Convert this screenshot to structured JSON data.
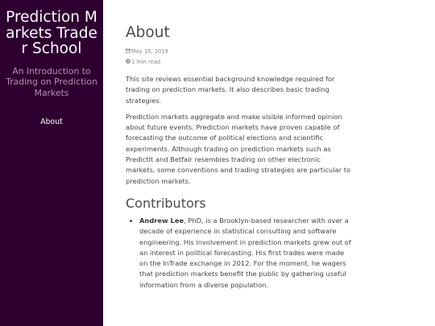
{
  "site": {
    "title": "Prediction Markets Trader School",
    "description": "An Introduction to Trading on Prediction Markets",
    "nav": [
      "About"
    ]
  },
  "page": {
    "title": "About",
    "date": "May 15, 2019",
    "read_time": "1 min read",
    "paragraphs": [
      "This site reviews essential background knowledge required for trading on prediction markets. It also describes basic trading strategies.",
      "Prediction markets aggregate and make visible informed opinion about future events. Prediction markets have proven capable of forecasting the outcome of political elections and scientific experiments. Although trading on prediction markets such as PredictIt and Betfair resembles trading on other electronic markets, some conventions and trading strategies are particular to prediction markets."
    ],
    "contributors_heading": "Contributors",
    "contributors": [
      {
        "name": "Andrew Lee",
        "bio": ", PhD, is a Brooklyn-based researcher with over a decade of experience in statistical consulting and software engineering. His involvement in prediction markets grew out of an interest in political forecasting. His first trades were made on the InTrade exchange in 2012. For the moment, he wagers that prediction markets benefit the public by gathering useful information from a diverse population."
      }
    ]
  },
  "icons": {
    "date": "calendar-icon",
    "read_time": "clock-icon"
  },
  "colors": {
    "sidebar_bg": "#2d0030",
    "sidebar_desc": "#b98db5"
  }
}
